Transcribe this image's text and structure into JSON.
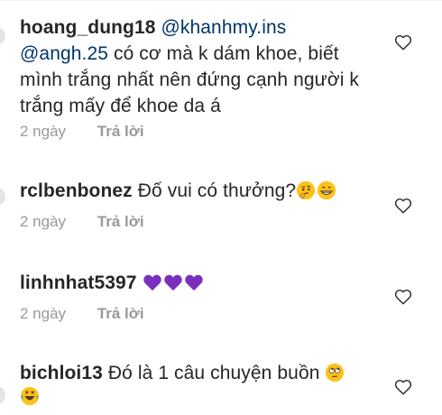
{
  "comments": [
    {
      "username": "hoang_dung18",
      "mention1": "@khanhmy.ins",
      "mention2": "@angh.25",
      "text": " có cơ mà k dám khoe, biết mình trắng nhất nên đứng cạnh người k trắng mấy để khoe da á",
      "time": "2 ngày",
      "reply": "Trả lời"
    },
    {
      "username": "rclbenbonez",
      "text": "Đố vui có thưởng?",
      "emojis": [
        "thinking-face",
        "grinning-face"
      ],
      "time": "2 ngày",
      "reply": "Trả lời"
    },
    {
      "username": "linhnhat5397",
      "text": "",
      "emojis": [
        "purple-heart",
        "purple-heart",
        "purple-heart"
      ],
      "time": "2 ngày",
      "reply": "Trả lời"
    },
    {
      "username": "bichloi13",
      "text": "Đó là 1 câu chuyện buồn",
      "emojis": [
        "eye-roll-face",
        "rofl-face"
      ]
    }
  ],
  "colors": {
    "text": "#262626",
    "meta": "#999999",
    "mention": "#003569",
    "purple_heart": "#7b2fbf",
    "emoji_yellow": "#fcc21b"
  }
}
